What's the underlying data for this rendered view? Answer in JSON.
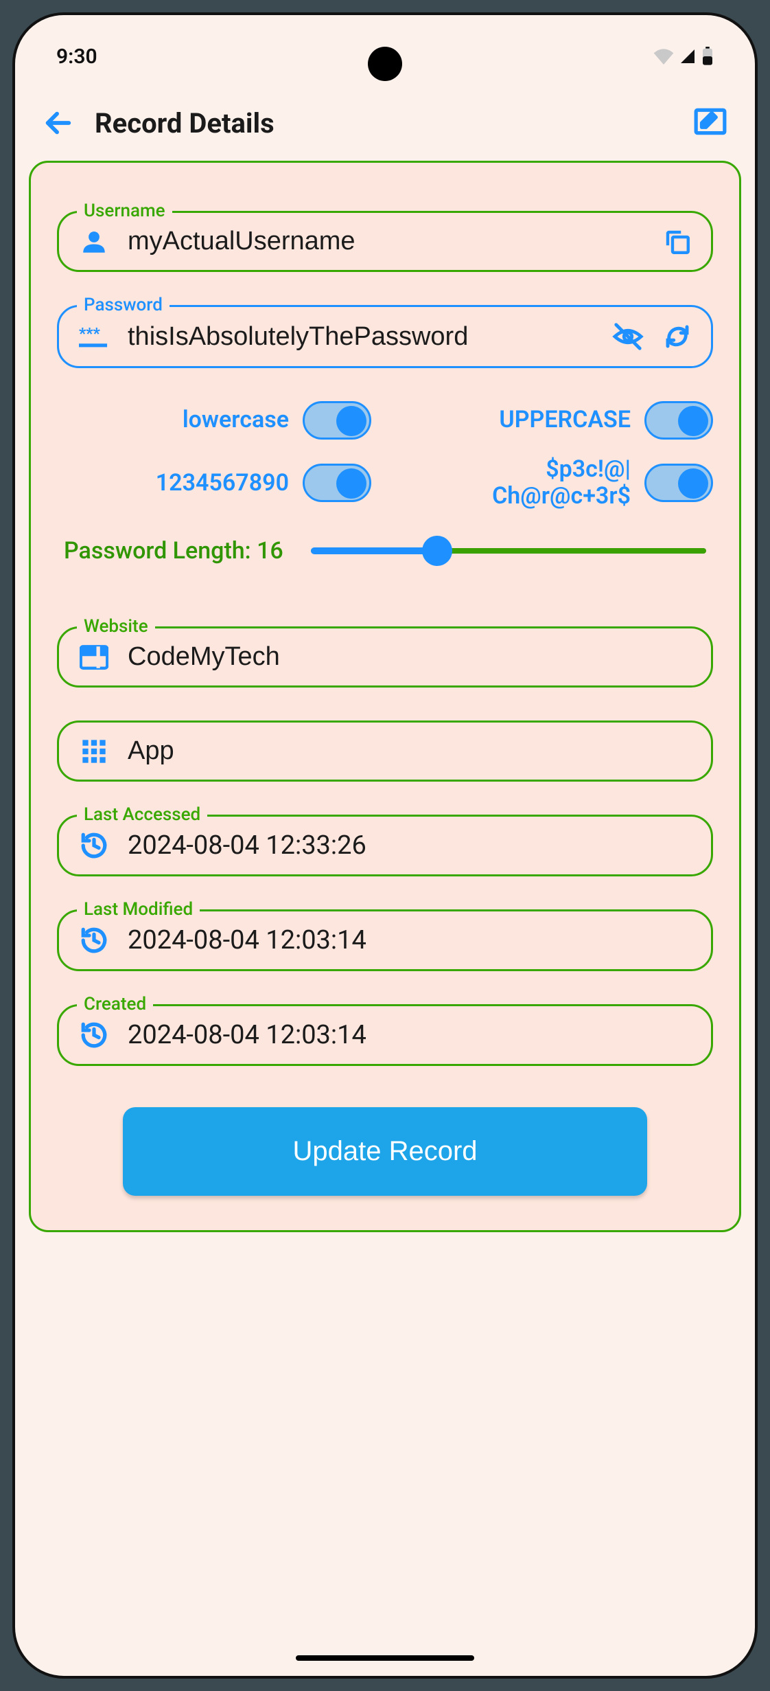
{
  "statusbar": {
    "time": "9:30"
  },
  "appbar": {
    "title": "Record Details"
  },
  "fields": {
    "username": {
      "label": "Username",
      "value": "myActualUsername"
    },
    "password": {
      "label": "Password",
      "value": "thisIsAbsolutelyThePassword"
    },
    "website": {
      "label": "Website",
      "value": "CodeMyTech"
    },
    "app": {
      "label": "",
      "value": "App"
    },
    "last_accessed": {
      "label": "Last Accessed",
      "value": "2024-08-04 12:33:26"
    },
    "last_modified": {
      "label": "Last Modified",
      "value": "2024-08-04 12:03:14"
    },
    "created": {
      "label": "Created",
      "value": "2024-08-04 12:03:14"
    }
  },
  "toggles": {
    "lowercase": {
      "label": "lowercase",
      "on": true
    },
    "uppercase": {
      "label": "UPPERCASE",
      "on": true
    },
    "digits": {
      "label": "1234567890",
      "on": true
    },
    "special": {
      "label": "$p3c!@|\nCh@r@c+3r$",
      "on": true
    }
  },
  "password_length": {
    "prefix": "Password Length: ",
    "value": 16
  },
  "submit": {
    "label": "Update Record"
  },
  "colors": {
    "accent_blue": "#1e90ff",
    "accent_green": "#38a700"
  }
}
